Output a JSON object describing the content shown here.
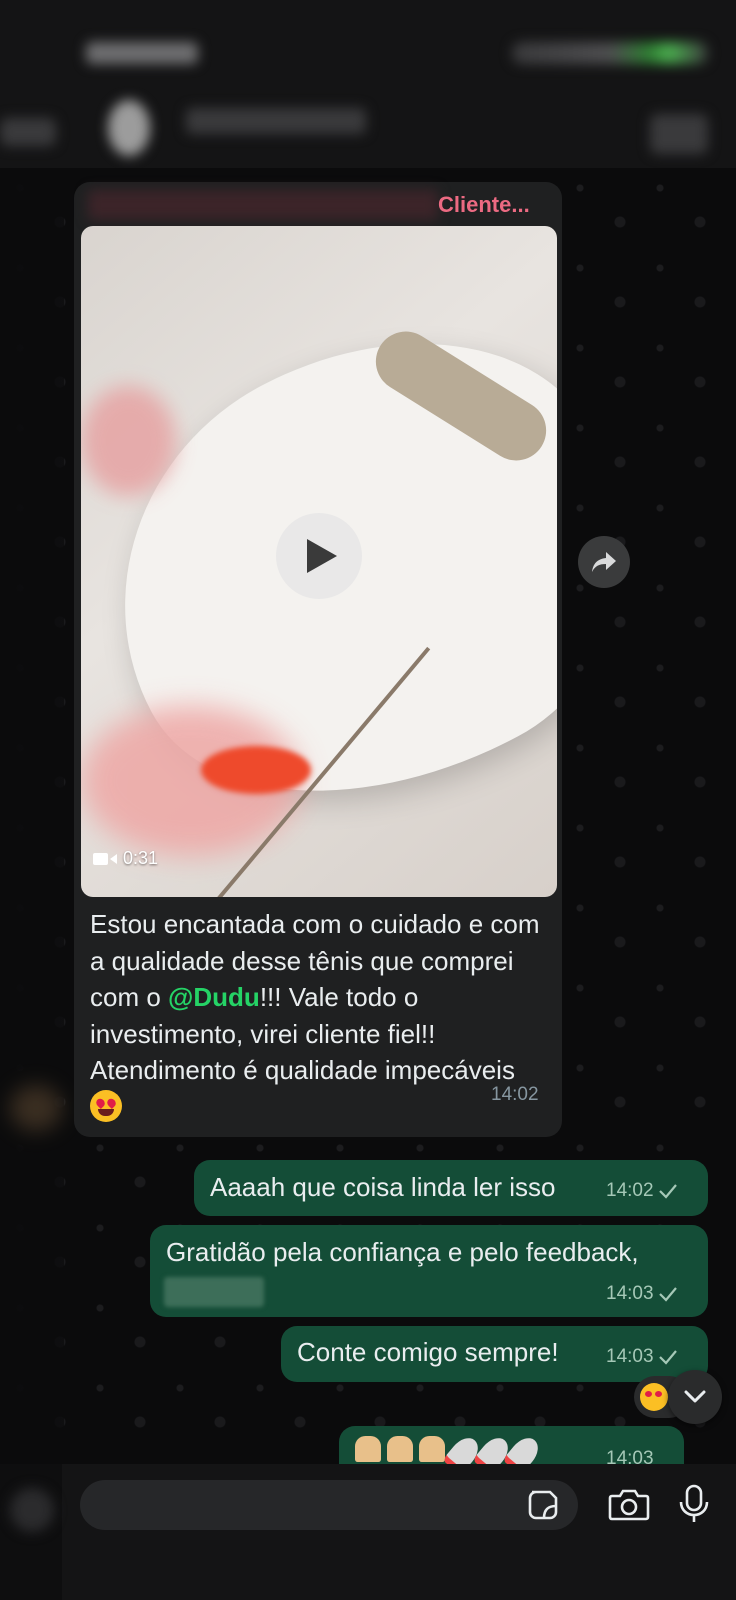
{
  "chat": {
    "incoming": {
      "reply_sender": "Cliente...",
      "video_duration": "0:31",
      "caption_before": "Estou encantada com o cuidado e com a qualidade desse tênis que comprei com o ",
      "mention": "@Dudu",
      "caption_after": "!!! Vale todo o investimento, virei cliente fiel!! Atendimento é qualidade impecáveis ",
      "time": "14:02"
    },
    "outgoing": [
      {
        "text": "Aaaah que coisa linda ler isso",
        "time": "14:02"
      },
      {
        "text": "Gratidão pela confiança e pelo feedback,",
        "time": "14:03"
      },
      {
        "text": "Conte comigo sempre!",
        "time": "14:03"
      },
      {
        "text": "",
        "time": "14:03"
      }
    ]
  },
  "icons": {
    "play": "play-icon",
    "forward": "forward-icon",
    "video": "video-camera-icon",
    "check": "check-icon",
    "sticker": "sticker-icon",
    "camera": "camera-icon",
    "mic": "microphone-icon",
    "scroll": "chevron-down-icon",
    "reaction": "heart-eyes-emoji"
  },
  "colors": {
    "incoming_bubble": "#1f2021",
    "outgoing_bubble": "#144d37",
    "mention": "#25d366",
    "sender_name": "#ec6a82",
    "timestamp": "#8696a0"
  }
}
